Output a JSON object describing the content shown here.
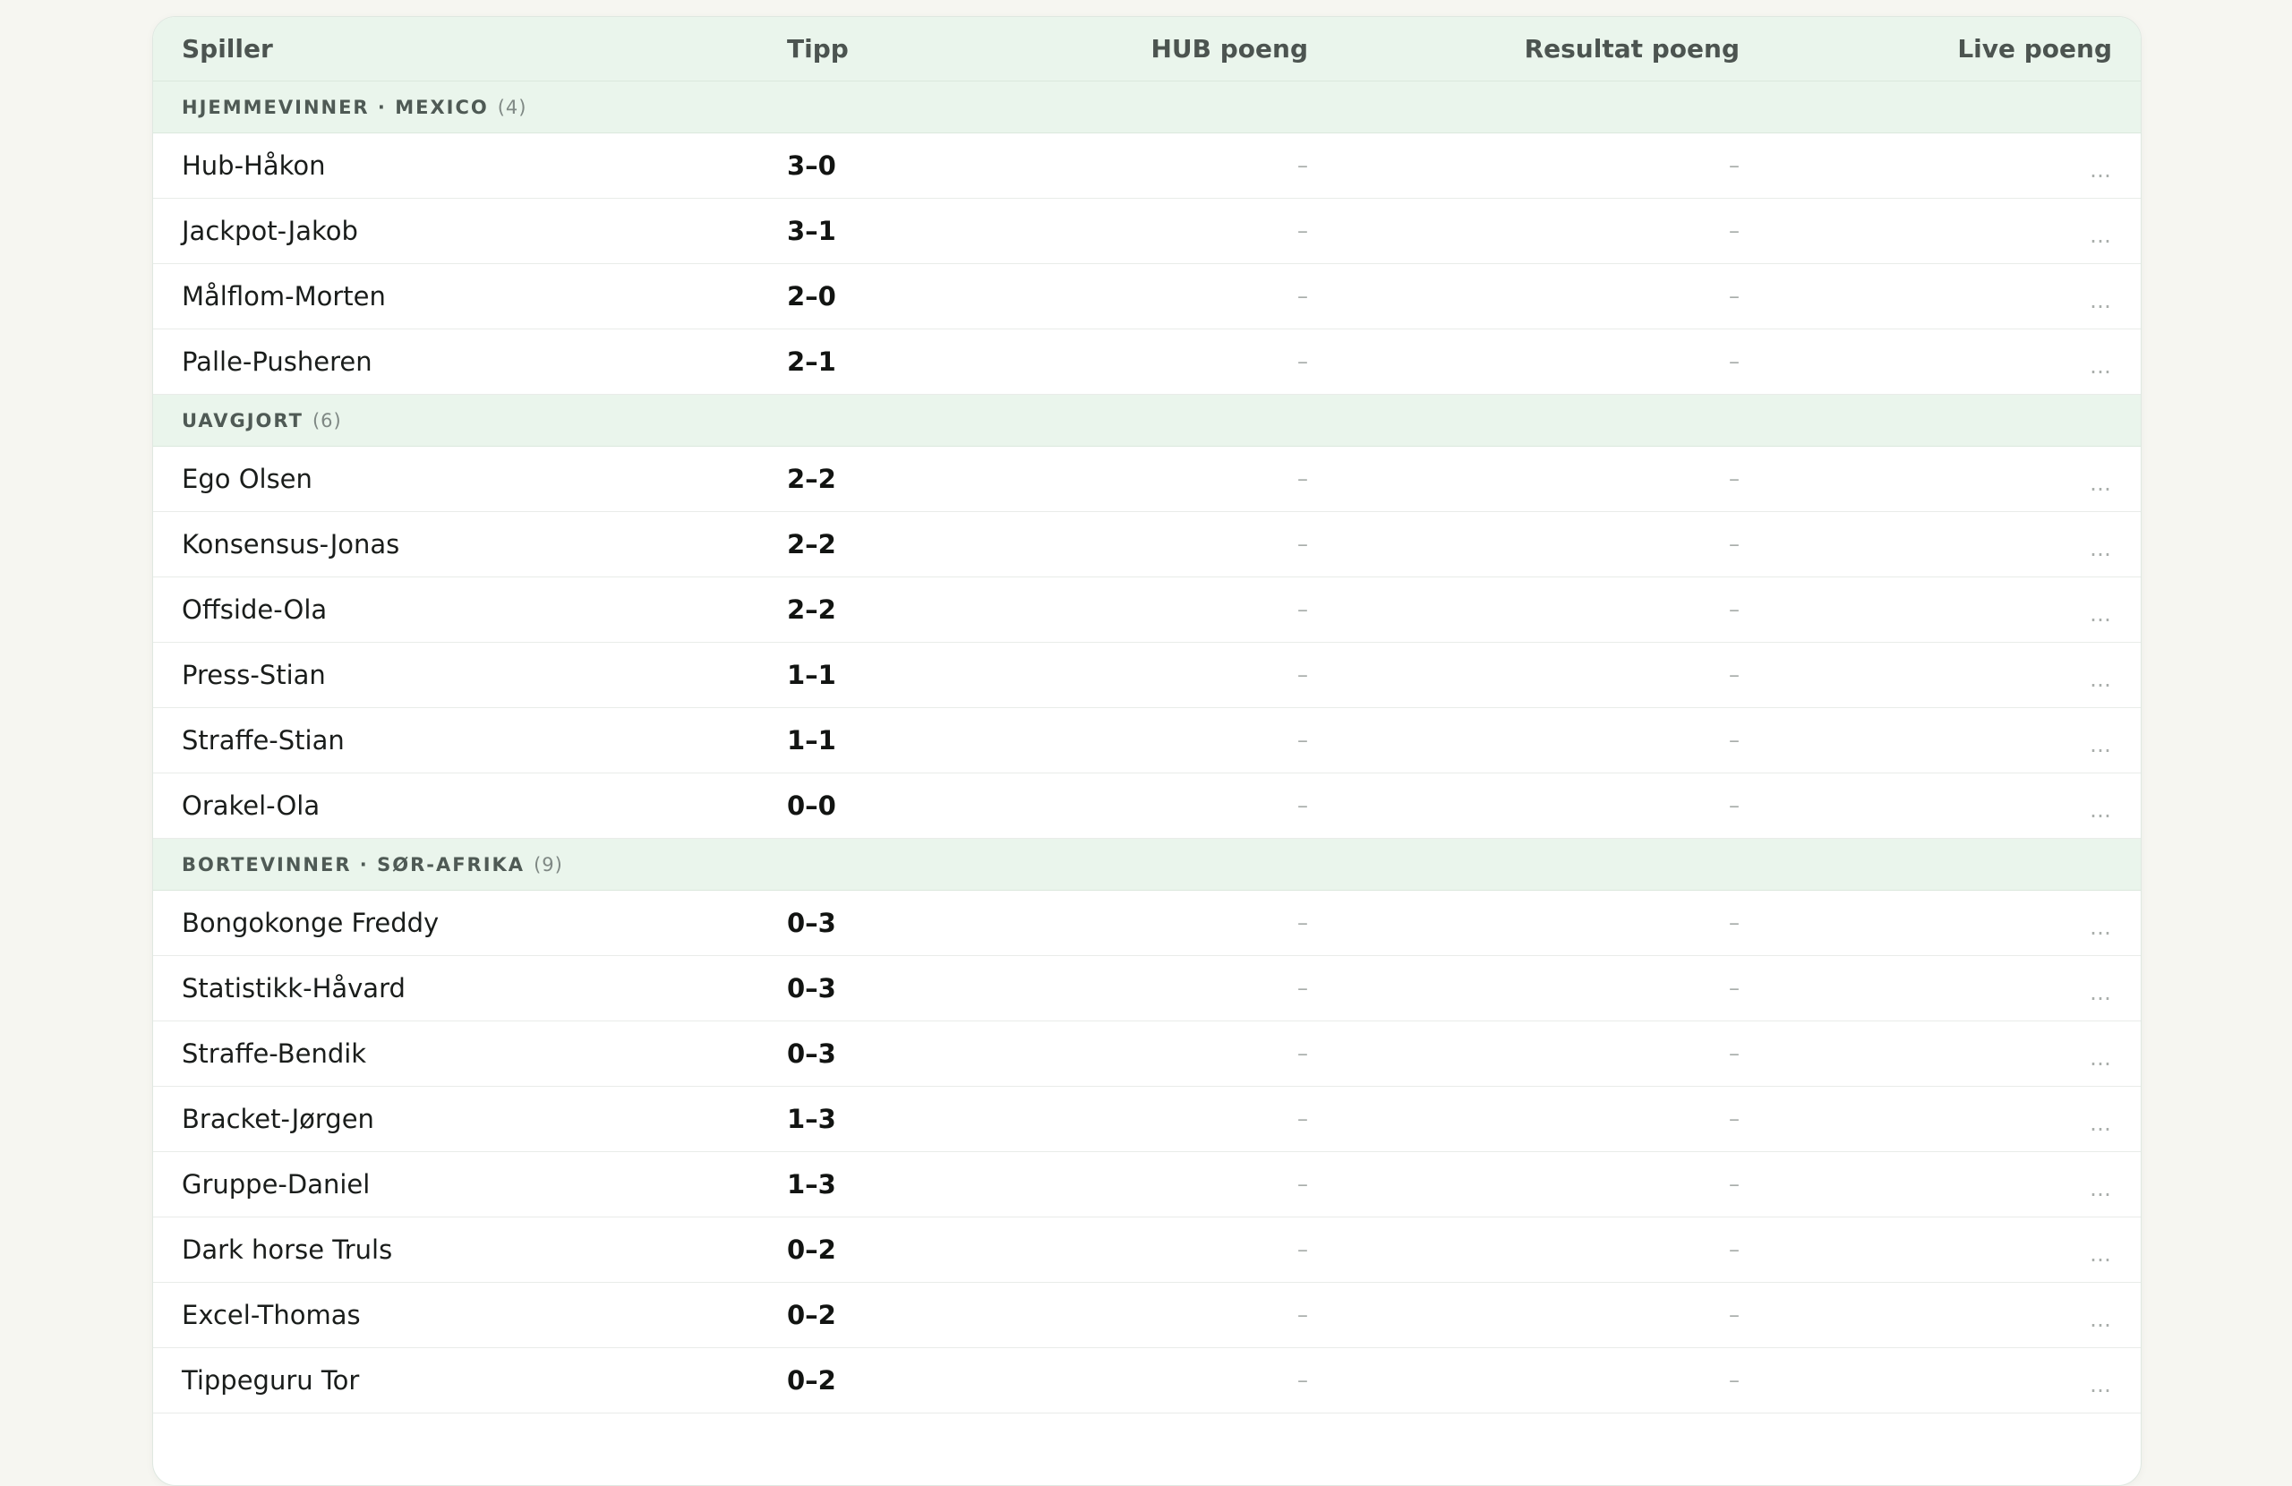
{
  "columns": {
    "player": "Spiller",
    "tip": "Tipp",
    "hub_points": "HUB poeng",
    "result_points": "Resultat poeng",
    "live_points": "Live poeng"
  },
  "groups": [
    {
      "label": "HJEMMEVINNER · MEXICO",
      "count": "(4)",
      "rows": [
        {
          "player": "Hub-Håkon",
          "tip": "3–0",
          "hub": "–",
          "result": "–",
          "live": "…"
        },
        {
          "player": "Jackpot-Jakob",
          "tip": "3–1",
          "hub": "–",
          "result": "–",
          "live": "…"
        },
        {
          "player": "Målflom-Morten",
          "tip": "2–0",
          "hub": "–",
          "result": "–",
          "live": "…"
        },
        {
          "player": "Palle-Pusheren",
          "tip": "2–1",
          "hub": "–",
          "result": "–",
          "live": "…"
        }
      ]
    },
    {
      "label": "UAVGJORT",
      "count": "(6)",
      "rows": [
        {
          "player": "Ego Olsen",
          "tip": "2–2",
          "hub": "–",
          "result": "–",
          "live": "…"
        },
        {
          "player": "Konsensus-Jonas",
          "tip": "2–2",
          "hub": "–",
          "result": "–",
          "live": "…"
        },
        {
          "player": "Offside-Ola",
          "tip": "2–2",
          "hub": "–",
          "result": "–",
          "live": "…"
        },
        {
          "player": "Press-Stian",
          "tip": "1–1",
          "hub": "–",
          "result": "–",
          "live": "…"
        },
        {
          "player": "Straffe-Stian",
          "tip": "1–1",
          "hub": "–",
          "result": "–",
          "live": "…"
        },
        {
          "player": "Orakel-Ola",
          "tip": "0–0",
          "hub": "–",
          "result": "–",
          "live": "…"
        }
      ]
    },
    {
      "label": "BORTEVINNER · SØR-AFRIKA",
      "count": "(9)",
      "rows": [
        {
          "player": "Bongokonge Freddy",
          "tip": "0–3",
          "hub": "–",
          "result": "–",
          "live": "…"
        },
        {
          "player": "Statistikk-Håvard",
          "tip": "0–3",
          "hub": "–",
          "result": "–",
          "live": "…"
        },
        {
          "player": "Straffe-Bendik",
          "tip": "0–3",
          "hub": "–",
          "result": "–",
          "live": "…"
        },
        {
          "player": "Bracket-Jørgen",
          "tip": "1–3",
          "hub": "–",
          "result": "–",
          "live": "…"
        },
        {
          "player": "Gruppe-Daniel",
          "tip": "1–3",
          "hub": "–",
          "result": "–",
          "live": "…"
        },
        {
          "player": "Dark horse Truls",
          "tip": "0–2",
          "hub": "–",
          "result": "–",
          "live": "…"
        },
        {
          "player": "Excel-Thomas",
          "tip": "0–2",
          "hub": "–",
          "result": "–",
          "live": "…"
        },
        {
          "player": "Tippeguru Tor",
          "tip": "0–2",
          "hub": "–",
          "result": "–",
          "live": "…"
        }
      ]
    }
  ]
}
